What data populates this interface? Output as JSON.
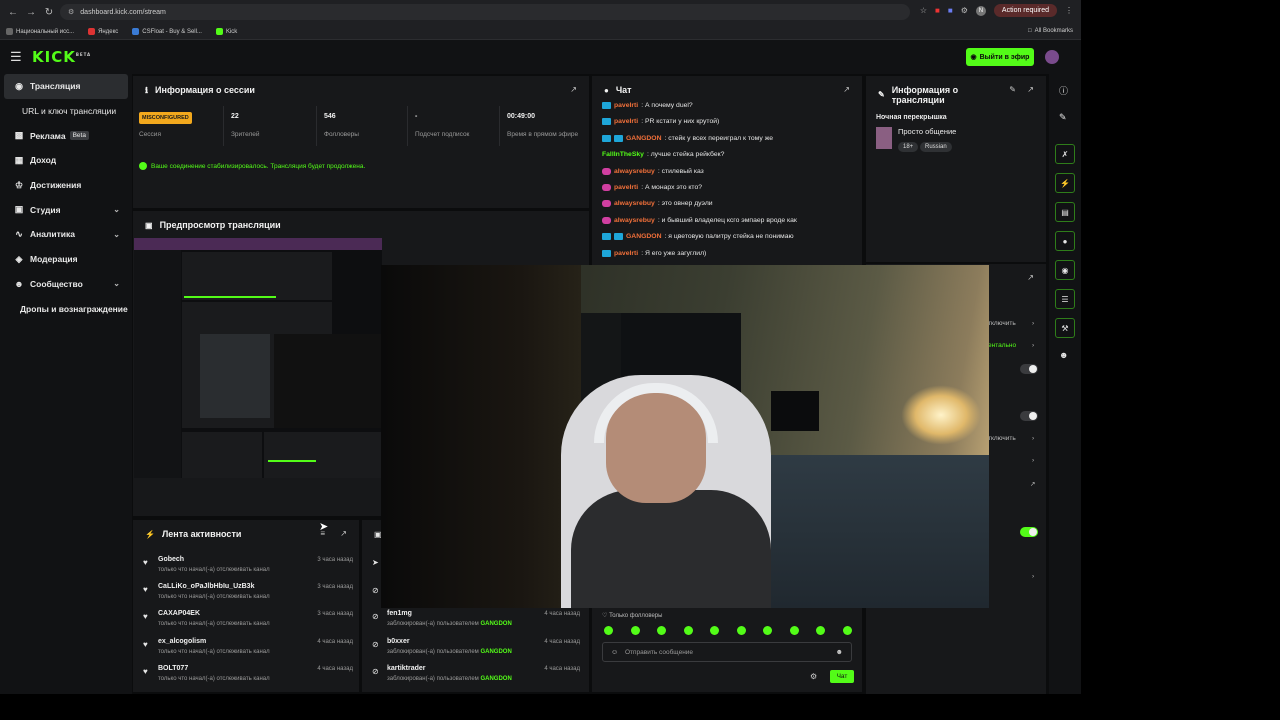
{
  "browser": {
    "url": "dashboard.kick.com/stream",
    "action_required": "Action required",
    "bookmarks": [
      "Национальный исс...",
      "Яндекс",
      "CSFloat - Buy & Sell...",
      "Kick"
    ],
    "all_bookmarks": "All Bookmarks"
  },
  "header": {
    "logo": "KICK",
    "logo_badge": "BETA",
    "go_live": "Выйти в эфир"
  },
  "sidebar": {
    "items": [
      {
        "label": "Трансляция",
        "icon": "broadcast-icon"
      },
      {
        "label": "URL и ключ трансляции"
      },
      {
        "label": "Реклама",
        "badge": "Beta",
        "icon": "ads-icon"
      },
      {
        "label": "Доход",
        "icon": "revenue-icon"
      },
      {
        "label": "Достижения",
        "icon": "trophy-icon"
      },
      {
        "label": "Студия",
        "icon": "studio-icon"
      },
      {
        "label": "Аналитика",
        "icon": "analytics-icon"
      },
      {
        "label": "Модерация",
        "icon": "moderation-icon"
      },
      {
        "label": "Сообщество",
        "icon": "community-icon"
      },
      {
        "label": "Дропы и вознаграждение"
      }
    ]
  },
  "session": {
    "title": "Информация о сессии",
    "badge": "MISCONFIGURED",
    "badge_label": "Сессия",
    "stats": [
      {
        "value": "22",
        "label": "Зрителей"
      },
      {
        "value": "546",
        "label": "Фолловеры"
      },
      {
        "value": "-",
        "label": "Подсчет подписок"
      },
      {
        "value": "00:49:00",
        "label": "Время в прямом эфире"
      }
    ],
    "status": "Ваше соединение стабилизировалось. Трансляция будет продолжена."
  },
  "preview": {
    "title": "Предпросмотр трансляции"
  },
  "chat": {
    "title": "Чат",
    "messages": [
      {
        "user": "paveIrti",
        "text": ": А почему duel?",
        "color": "#f2703a",
        "badge": "blue"
      },
      {
        "user": "paveIrti",
        "text": ": PR кстати у них крутой)",
        "color": "#f2703a",
        "badge": "blue"
      },
      {
        "user": "GANGDON",
        "text": ": стейк у всех переиграл к тому же",
        "color": "#f2703a",
        "badge": "blue2"
      },
      {
        "user": "FallInTheSky",
        "text": ": лучше стейка рейкбек?",
        "color": "#53fc18",
        "badge": ""
      },
      {
        "user": "alwaysrebuy",
        "text": ": стилевый каз",
        "color": "#f2703a",
        "badge": "pink"
      },
      {
        "user": "paveIrti",
        "text": ": А монарх это кто?",
        "color": "#f2703a",
        "badge": "pink"
      },
      {
        "user": "alwaysrebuy",
        "text": ": это овнер дуэли",
        "color": "#f2703a",
        "badge": "pink"
      },
      {
        "user": "alwaysrebuy",
        "text": ": и бывший владелец ксго эмпаер вроде как",
        "color": "#f2703a",
        "badge": "pink"
      },
      {
        "user": "GANGDON",
        "text": ": я цветовую палитру стейка не понимаю",
        "color": "#f2703a",
        "badge": "blue2"
      },
      {
        "user": "paveIrti",
        "text": ": Я его уже загуглил)",
        "color": "#f2703a",
        "badge": "blue"
      }
    ],
    "followers_only": "Только фолловеры",
    "input_placeholder": "Отправить сообщение",
    "send": "Чат"
  },
  "activity": {
    "title": "Лента активности",
    "items": [
      {
        "name": "Gobech",
        "desc": "только что начал(-а) отслеживать канал",
        "time": "3 часа назад"
      },
      {
        "name": "CaLLiKo_oPaJlbHbIu_UzB3k",
        "desc": "только что начал(-а) отслеживать канал",
        "time": "3 часа назад"
      },
      {
        "name": "CAXAP04EK",
        "desc": "только что начал(-а) отслеживать канал",
        "time": "3 часа назад"
      },
      {
        "name": "ex_alcogolism",
        "desc": "только что начал(-а) отслеживать канал",
        "time": "4 часа назад"
      },
      {
        "name": "BOLT077",
        "desc": "только что начал(-а) отслеживать канал",
        "time": "4 часа назад"
      }
    ]
  },
  "moderation_feed": {
    "items": [
      {
        "name": "fen1mg",
        "desc": "заблокирован(-а) пользователем",
        "by": "GANGDON",
        "time": "4 часа назад"
      },
      {
        "name": "b0xxer",
        "desc": "заблокирован(-а) пользователем",
        "by": "GANGDON",
        "time": "4 часа назад"
      },
      {
        "name": "kartiktrader",
        "desc": "заблокирован(-а) пользователем",
        "by": "GANGDON",
        "time": "4 часа назад"
      }
    ]
  },
  "stream_info": {
    "title": "Информация о трансляции",
    "overlay_label": "Ночная перекрышка",
    "stream_title": "Просто общение",
    "tags": [
      "18+",
      "Russian"
    ]
  },
  "settings_fragments": {
    "disable_1": "тключить",
    "enabled": "ентально",
    "disable_2": "тключить"
  },
  "colors": {
    "accent": "#53fc18",
    "warning": "#f2a81d",
    "panel": "#17181a"
  }
}
